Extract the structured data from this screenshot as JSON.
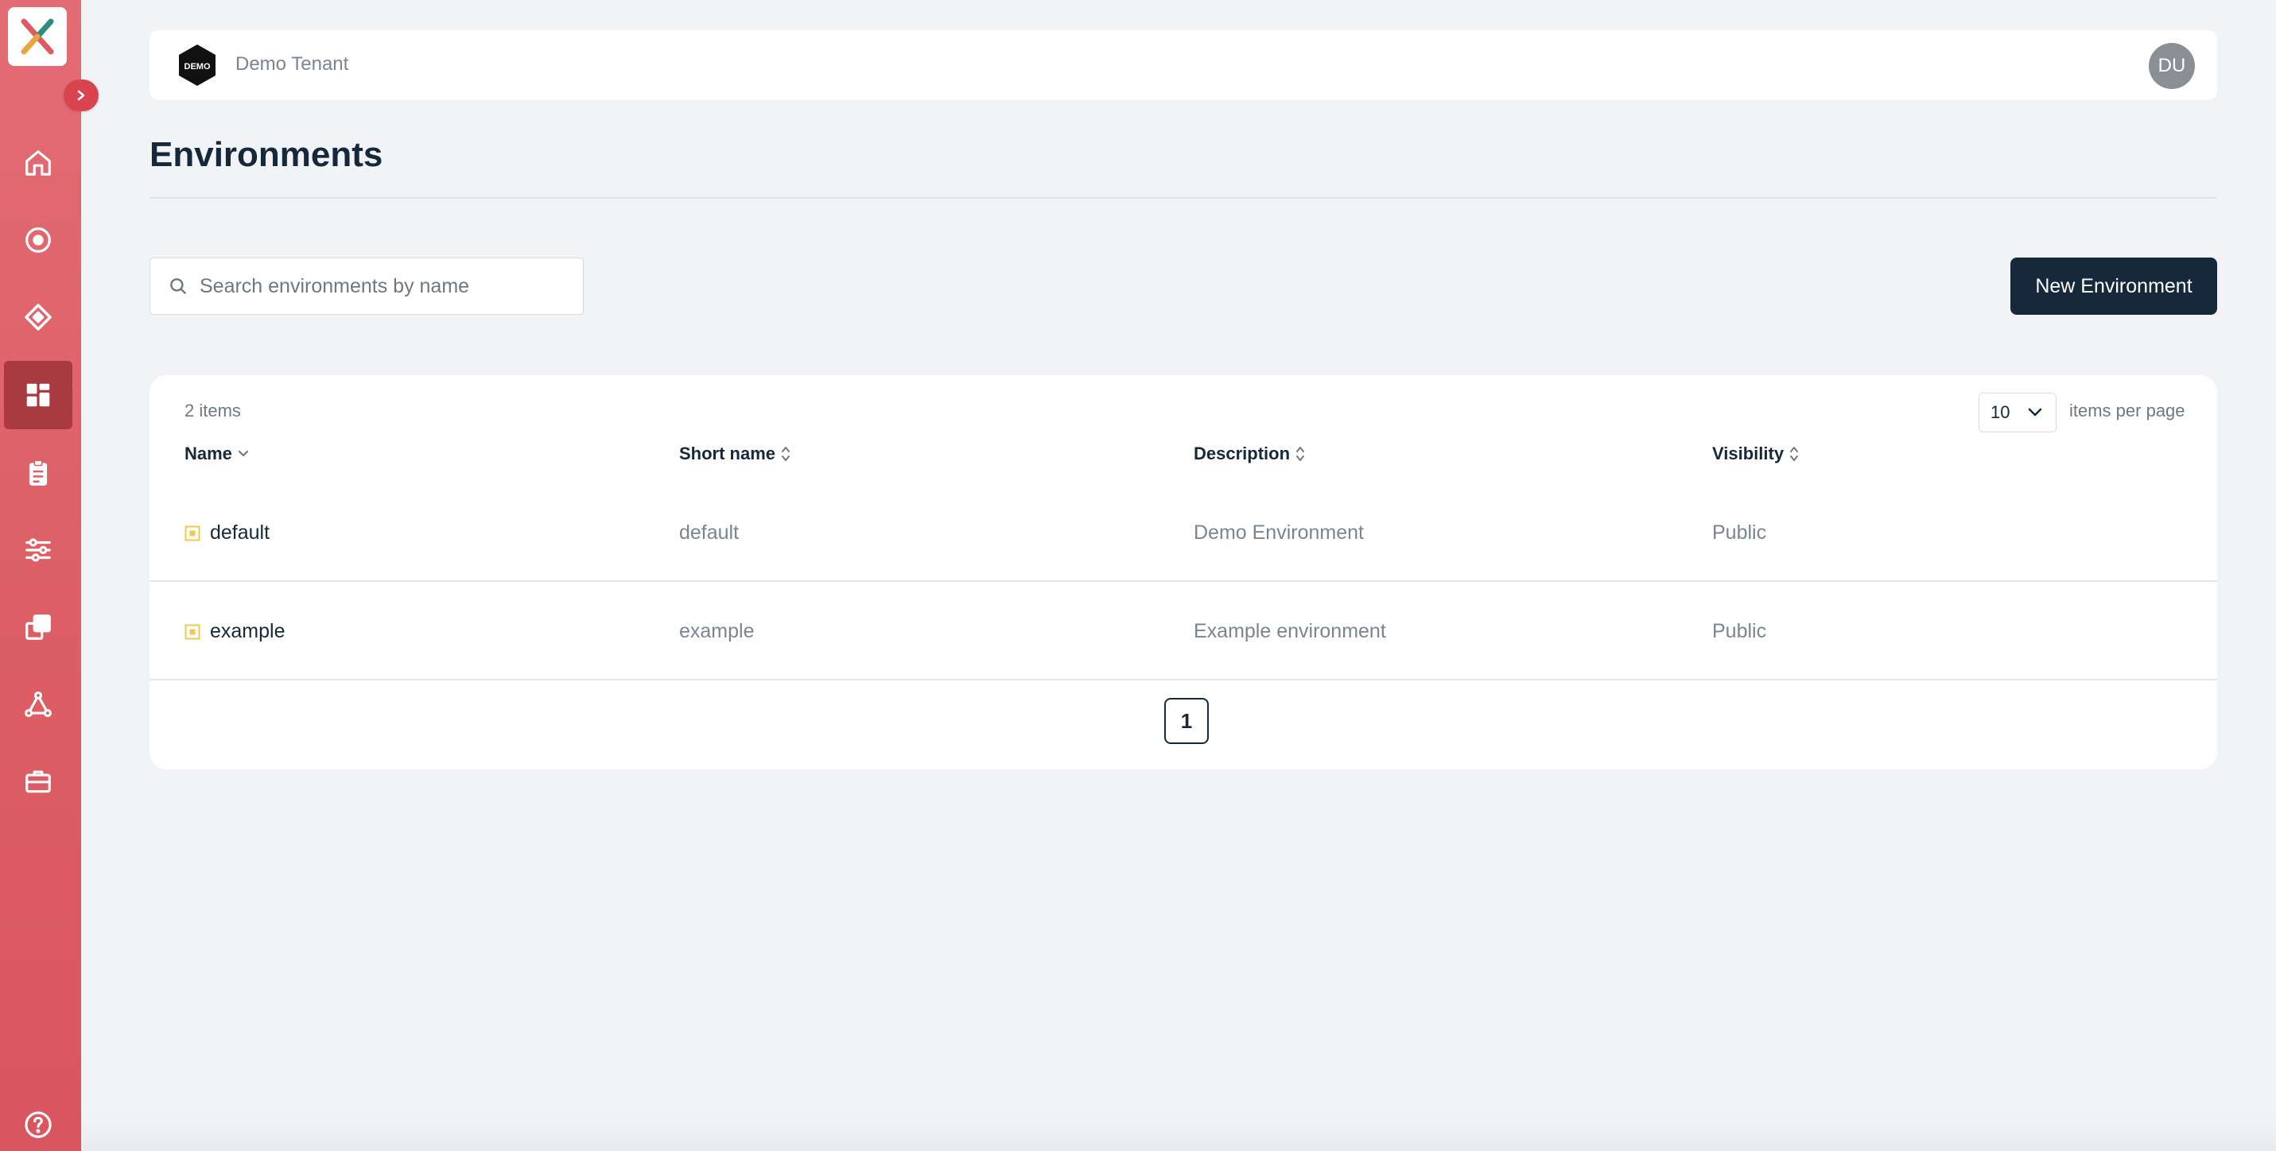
{
  "sidebar": {
    "items": [
      {
        "icon": "home-icon",
        "active": false
      },
      {
        "icon": "target-icon",
        "active": false
      },
      {
        "icon": "diamond-icon",
        "active": false
      },
      {
        "icon": "dashboard-grid-icon",
        "active": true
      },
      {
        "icon": "clipboard-icon",
        "active": false
      },
      {
        "icon": "sliders-icon",
        "active": false
      },
      {
        "icon": "layers-icon",
        "active": false
      },
      {
        "icon": "network-icon",
        "active": false
      },
      {
        "icon": "toolbox-icon",
        "active": false
      }
    ],
    "help_icon": "help-icon",
    "colors": {
      "gradient_top": "#e46c75",
      "gradient_bottom": "#d9565f",
      "active": "#a93a41"
    }
  },
  "header": {
    "tenant_logo_text": "DEMO",
    "tenant_name": "Demo Tenant",
    "avatar_initials": "DU"
  },
  "page": {
    "title": "Environments"
  },
  "search": {
    "placeholder": "Search environments by name",
    "value": ""
  },
  "toolbar": {
    "new_label": "New Environment"
  },
  "table": {
    "item_count": "2 items",
    "per_page_value": "10",
    "per_page_label": "items per page",
    "columns": [
      "Name",
      "Short name",
      "Description",
      "Visibility"
    ],
    "rows": [
      {
        "name": "default",
        "short_name": "default",
        "description": "Demo Environment",
        "visibility": "Public"
      },
      {
        "name": "example",
        "short_name": "example",
        "description": "Example environment",
        "visibility": "Public"
      }
    ],
    "pagination": {
      "current_page": "1"
    }
  },
  "colors": {
    "primary_dark": "#15293b",
    "background": "#f2f3f7",
    "env_icon": "#f2c94c"
  }
}
